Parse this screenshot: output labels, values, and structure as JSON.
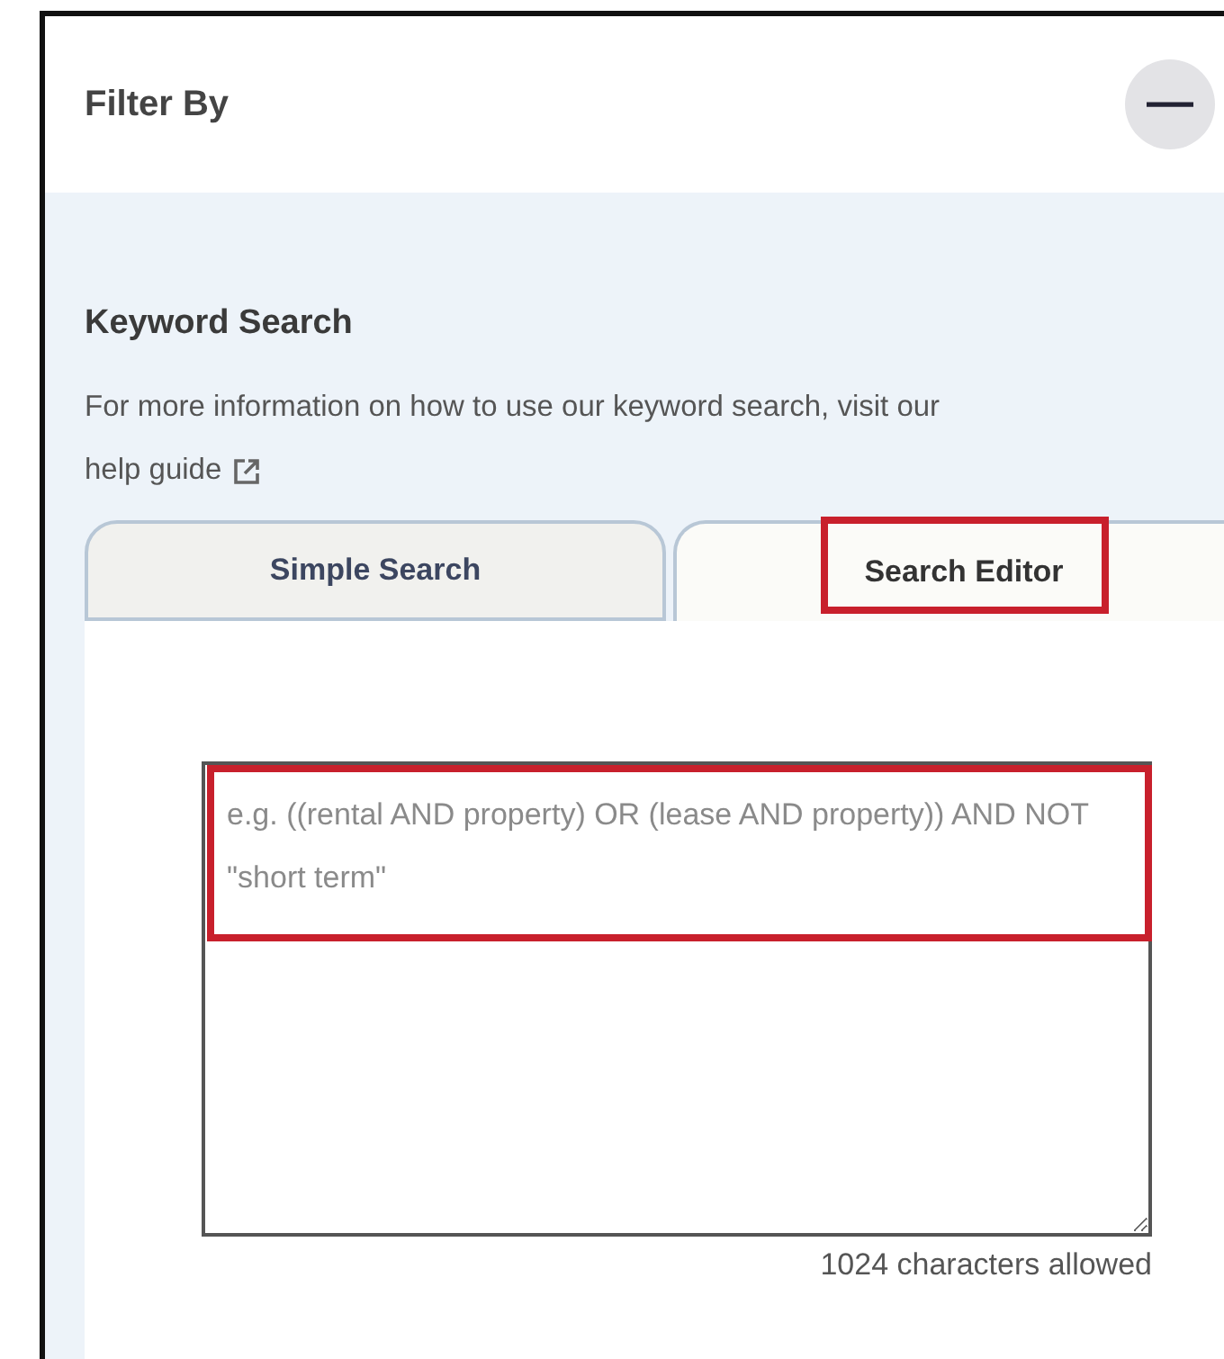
{
  "panel": {
    "title": "Filter By",
    "collapse_button": "—"
  },
  "section": {
    "heading": "Keyword Search",
    "help_text": "For more information on how to use our keyword search, visit our",
    "help_link": "help guide"
  },
  "tabs": [
    {
      "label": "Simple Search",
      "selected": false,
      "highlighted": false
    },
    {
      "label": "Search Editor",
      "selected": true,
      "highlighted": true
    }
  ],
  "editor": {
    "placeholder": "e.g. ((rental AND property) OR (lease AND property)) AND NOT \"short term\"",
    "highlighted": true,
    "counter": "1024 characters allowed"
  }
}
